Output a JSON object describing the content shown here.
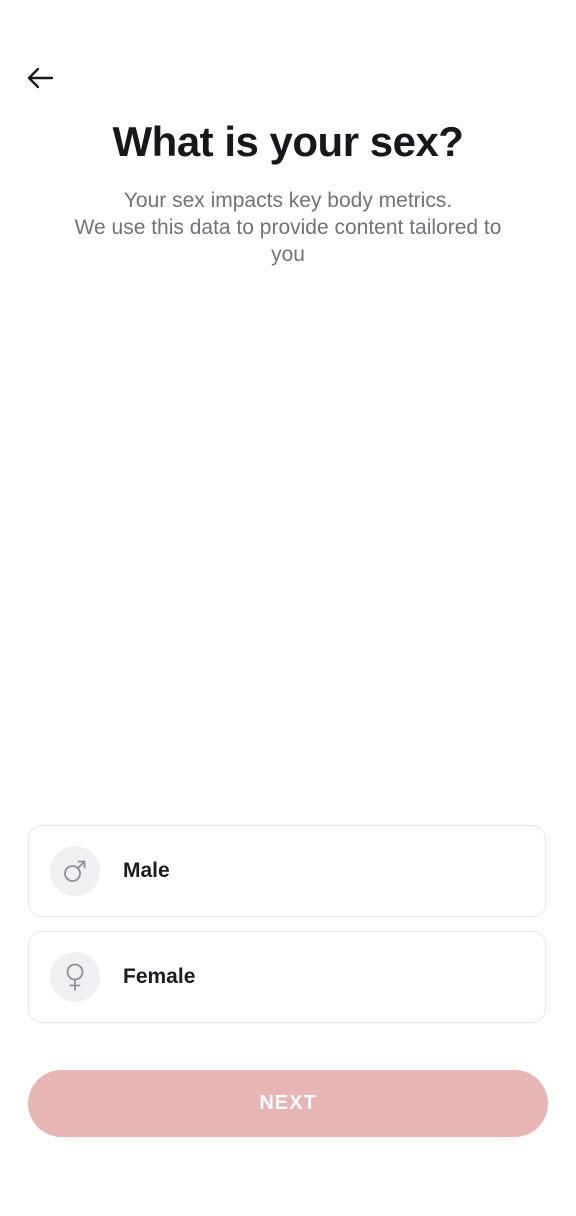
{
  "header": {
    "back_icon": "arrow-left-icon"
  },
  "title": "What is your sex?",
  "subtitle": {
    "line1": "Your sex impacts key body metrics.",
    "line2": "We use this data to provide content tailored to",
    "line3": "you"
  },
  "options": [
    {
      "label": "Male",
      "icon": "male-symbol-icon"
    },
    {
      "label": "Female",
      "icon": "female-symbol-icon"
    }
  ],
  "next_button": {
    "label": "NEXT",
    "state": "disabled",
    "color": "#e8b5b5"
  },
  "colors": {
    "title": "#17181c",
    "subtitle": "#707378",
    "icon_bg": "#eff0f2",
    "icon_stroke": "#8b9099",
    "border": "#e6e7ea"
  }
}
